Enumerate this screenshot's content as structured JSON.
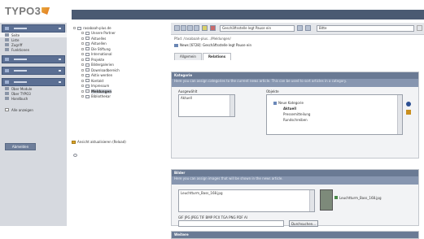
{
  "app": {
    "logo_text": "TYPO3"
  },
  "modules": {
    "groups": [
      {
        "label": "Web",
        "items": [
          "Seite",
          "Liste",
          "Zugriff",
          "Funktionen"
        ]
      },
      {
        "label": "Datei"
      },
      {
        "label": "Benutzer"
      },
      {
        "label": "Hilfe",
        "items": [
          "Über Module",
          "Über TYPO3",
          "Handbuch"
        ]
      }
    ],
    "show_all_label": "Alle anzeigen",
    "logout_label": "Abmelden"
  },
  "tree": {
    "root": "rasabaah-plus.de",
    "pages": [
      "Unsere Partner",
      "Aktuelles",
      "Aktuellen",
      "Die Stiftung",
      "International",
      "Projekte",
      "Bildergalerien",
      "Downloadbereich",
      "Aktiv werden",
      "Kontakt",
      "Impressum",
      "Meldungen",
      "Bibliothekar"
    ],
    "selected": "Meldungen",
    "footer": "Ansicht aktualisieren (Reload)"
  },
  "content": {
    "view_select": "Geschäftsstelle legt Pause ein",
    "mode_select": "Bitte",
    "path": "Pfad: /rasabaah-plus.../Meldungen/",
    "record_title": "News [6728]: Geschäftsstelle legt Pause ein",
    "tabs": [
      "Allgemein",
      "Relations"
    ],
    "active_tab": "Relations",
    "categories": {
      "title": "Kategorie",
      "desc": "Here you can assign categories to the current news article. This can be used to sort articles in a category.",
      "selected_label": "Ausgewählt",
      "objects_label": "Objekte",
      "selected_items": [
        "Aktuell"
      ],
      "tree_root": "Neue Kategorie",
      "tree_items": [
        "Aktuell",
        "Pressemitteilung",
        "Rundschreiben"
      ]
    },
    "images": {
      "title": "Bilder",
      "desc": "Here you can assign images that will be shown in the news article.",
      "file_name": "Leuchtturm_Bass_168.jpg",
      "file_name_2": "Leuchtturm_Bass_168.jpg",
      "allowed": "GIF JPG JPEG TIF BMP PCX TGA PNG PDF AI",
      "browse": "Durchsuchen..."
    },
    "next_section": "Weitere"
  }
}
